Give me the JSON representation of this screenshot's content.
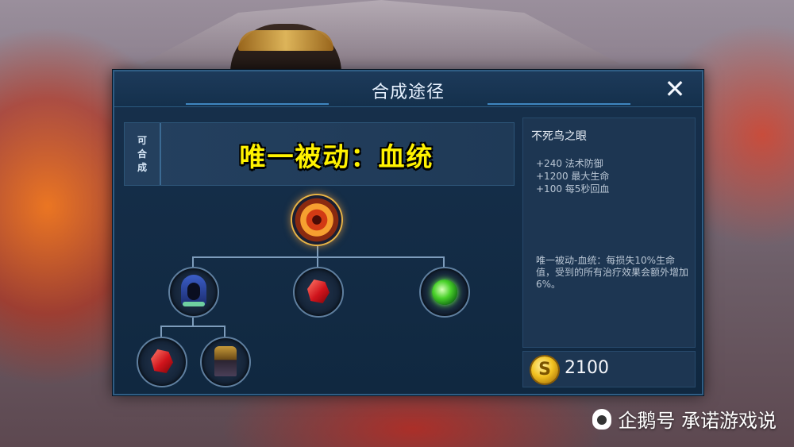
{
  "dialog": {
    "title": "合成途径",
    "close_symbol": "✕"
  },
  "banner": {
    "side_label": [
      "可",
      "合",
      "成"
    ],
    "text": "唯一被动：血统"
  },
  "tree": {
    "root": {
      "icon": "phoenix-eye-icon"
    },
    "level1": [
      {
        "icon": "hood-cloak-icon"
      },
      {
        "icon": "red-gem-icon"
      },
      {
        "icon": "green-orb-icon"
      }
    ],
    "level2": [
      {
        "icon": "red-gem-icon"
      },
      {
        "icon": "armor-icon"
      }
    ]
  },
  "item": {
    "name": "不死鸟之眼",
    "stats": [
      "+240 法术防御",
      "+1200 最大生命",
      "+100 每5秒回血"
    ],
    "passive": "唯一被动-血统：每损失10%生命值，受到的所有治疗效果会额外增加6%。",
    "price": "2100",
    "currency_icon": "gold-coin-icon"
  },
  "watermark": {
    "text": "企鹅号 承诺游戏说"
  }
}
